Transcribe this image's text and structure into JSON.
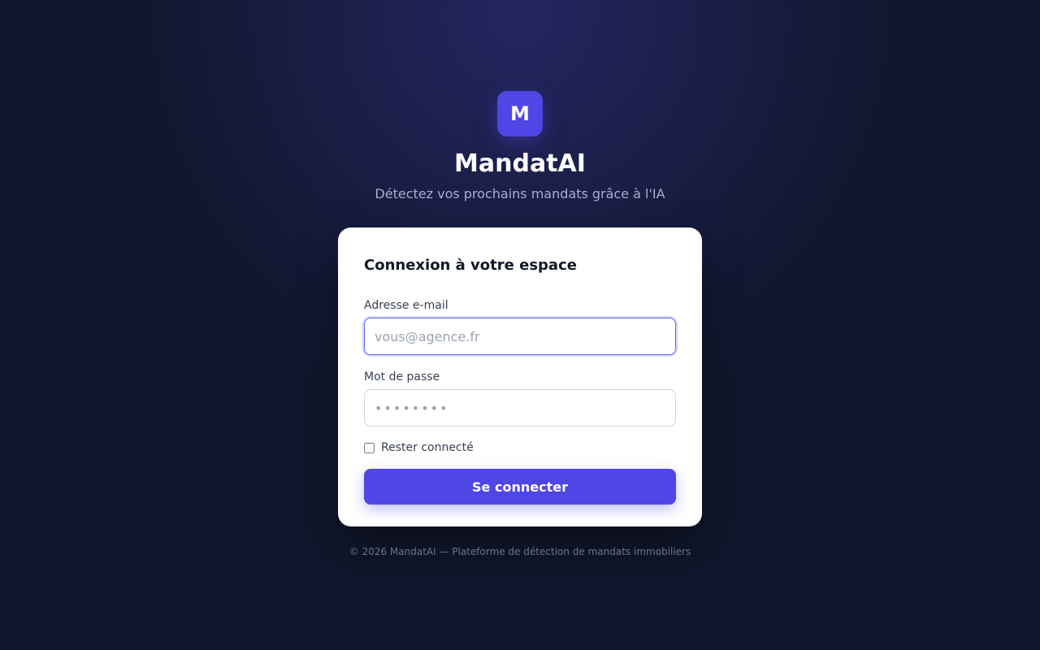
{
  "brand": {
    "logo_letter": "M",
    "logo_color": "#4f46e5",
    "name": "MandatAI",
    "tagline": "Détectez vos prochains mandats grâce à l'IA"
  },
  "login": {
    "title": "Connexion à votre espace",
    "email_label": "Adresse e-mail",
    "email_placeholder": "vous@agence.fr",
    "email_value": "",
    "password_label": "Mot de passe",
    "password_placeholder": "••••••••",
    "password_value": "",
    "remember_label": "Rester connecté",
    "remember_checked": false,
    "submit_label": "Se connecter",
    "accent_color": "#4f46e5"
  },
  "footer": {
    "text": "© 2026 MandatAI — Plateforme de détection de mandats immobiliers"
  }
}
